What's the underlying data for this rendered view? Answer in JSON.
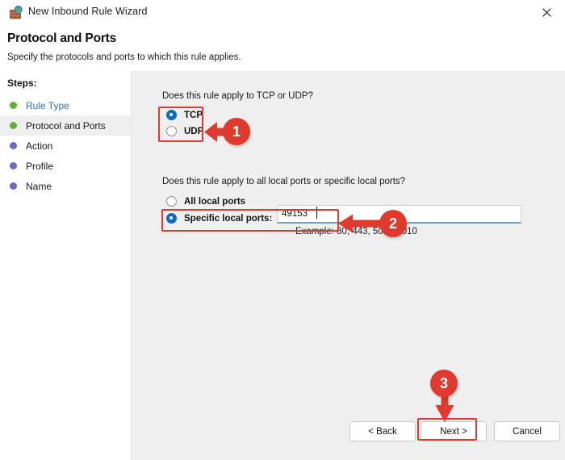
{
  "window": {
    "title": "New Inbound Rule Wizard",
    "app_icon": "firewall-globe-icon",
    "close_icon": "close-icon"
  },
  "header": {
    "title": "Protocol and Ports",
    "subtitle": "Specify the protocols and ports to which this rule applies."
  },
  "sidebar": {
    "label": "Steps:",
    "items": [
      {
        "label": "Rule Type",
        "bullet_color": "#5eb335",
        "state": "completed",
        "link": true
      },
      {
        "label": "Protocol and Ports",
        "bullet_color": "#5eb335",
        "state": "current",
        "link": false
      },
      {
        "label": "Action",
        "bullet_color": "#6a6ac4",
        "state": "upcoming",
        "link": false
      },
      {
        "label": "Profile",
        "bullet_color": "#6a6ac4",
        "state": "upcoming",
        "link": false
      },
      {
        "label": "Name",
        "bullet_color": "#6a6ac4",
        "state": "upcoming",
        "link": false
      }
    ]
  },
  "main": {
    "protocol_question": "Does this rule apply to TCP or UDP?",
    "protocol_options": [
      {
        "label": "TCP",
        "selected": true
      },
      {
        "label": "UDP",
        "selected": false
      }
    ],
    "ports_question": "Does this rule apply to all local ports or specific local ports?",
    "ports_options": [
      {
        "label": "All local ports",
        "selected": false
      },
      {
        "label": "Specific local ports:",
        "selected": true
      }
    ],
    "port_value": "49153",
    "port_placeholder": "",
    "example_text": "Example: 80, 443, 5000-5010"
  },
  "footer": {
    "back_label": "< Back",
    "next_label": "Next >",
    "cancel_label": "Cancel"
  },
  "annotations": {
    "color": "#e03a2f",
    "badges": [
      {
        "number": "1",
        "target": "protocol-radio-group"
      },
      {
        "number": "2",
        "target": "specific-local-ports-row"
      },
      {
        "number": "3",
        "target": "next-button"
      }
    ]
  },
  "colors": {
    "accent_blue": "#0c6ac4",
    "link_blue": "#2a6fc9",
    "content_bg": "#efefef",
    "sidebar_bg": "#ffffff",
    "annotation_red": "#e03a2f",
    "bullet_green": "#5eb335",
    "bullet_purple": "#6a6ac4"
  }
}
